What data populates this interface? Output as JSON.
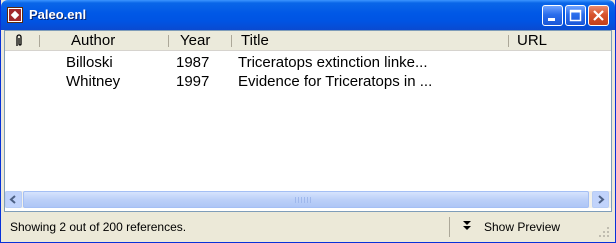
{
  "window": {
    "title": "Paleo.enl"
  },
  "columns": {
    "attachment_icon": "paperclip-icon",
    "author": "Author",
    "year": "Year",
    "title": "Title",
    "url": "URL"
  },
  "references": [
    {
      "author": "Billoski",
      "year": "1987",
      "title": "Triceratops extinction linke...",
      "url": ""
    },
    {
      "author": "Whitney",
      "year": "1997",
      "title": "Evidence for Triceratops in ...",
      "url": ""
    }
  ],
  "status": {
    "text": "Showing 2 out of 200 references.",
    "preview_label": "Show Preview"
  },
  "colors": {
    "titlebar": "#0054e3",
    "close_button": "#d8542e",
    "window_bg": "#ece9d8"
  }
}
